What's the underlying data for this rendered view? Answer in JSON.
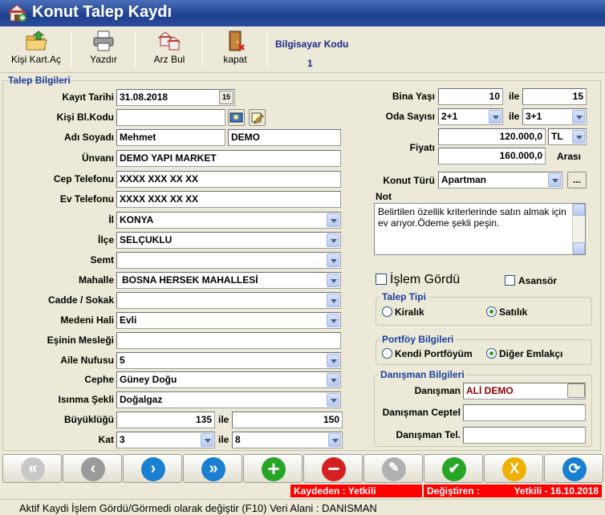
{
  "window": {
    "title": "Konut Talep Kaydı"
  },
  "toolbar": {
    "open_label": "Kişi Kart.Aç",
    "print_label": "Yazdır",
    "find_label": "Arz Bul",
    "close_label": "kapat",
    "pc_code_label": "Bilgisayar Kodu",
    "pc_code_value": "1"
  },
  "section": {
    "title": "Talep Bilgileri"
  },
  "form": {
    "kayit_tarihi": {
      "label": "Kayıt Tarihi",
      "value": "31.08.2018",
      "cal": "15"
    },
    "kisi_bl_kodu": {
      "label": "Kişi Bl.Kodu",
      "value": ""
    },
    "adi_soyadi": {
      "label": "Adı Soyadı",
      "first": "Mehmet",
      "last": "DEMO"
    },
    "unvani": {
      "label": "Ünvanı",
      "value": "DEMO YAPI MARKET"
    },
    "cep_telefonu": {
      "label": "Cep Telefonu",
      "value": "XXXX XXX XX XX"
    },
    "ev_telefonu": {
      "label": "Ev Telefonu",
      "value": "XXXX XXX XX XX"
    },
    "il": {
      "label": "İl",
      "value": "KONYA"
    },
    "ilce": {
      "label": "İlçe",
      "value": "SELÇUKLU"
    },
    "semt": {
      "label": "Semt",
      "value": ""
    },
    "mahalle": {
      "label": "Mahalle",
      "value": "BOSNA HERSEK MAHALLESİ"
    },
    "cadde": {
      "label": "Cadde / Sokak",
      "value": ""
    },
    "medeni_hali": {
      "label": "Medeni Hali",
      "value": "Evli"
    },
    "esinin_meslegi": {
      "label": "Eşinin Mesleği",
      "value": ""
    },
    "aile_nufusu": {
      "label": "Aile Nufusu",
      "value": "5"
    },
    "cephe": {
      "label": "Cephe",
      "value": "Güney Doğu"
    },
    "isinma": {
      "label": "Isınma Şekli",
      "value": "Doğalgaz"
    },
    "buyuklugu": {
      "label": "Büyüklüğü",
      "from": "135",
      "ile": "ile",
      "to": "150"
    },
    "kat": {
      "label": "Kat",
      "from": "3",
      "ile": "ile",
      "to": "8"
    }
  },
  "right": {
    "bina_yasi": {
      "label": "Bina Yaşı",
      "from": "10",
      "ile": "ile",
      "to": "15"
    },
    "oda_sayisi": {
      "label": "Oda Sayısı",
      "from": "2+1",
      "ile": "ile",
      "to": "3+1"
    },
    "fiyati": {
      "label": "Fiyatı",
      "from": "120.000,0",
      "currency": "TL",
      "to": "160.000,0",
      "arasi": "Arası"
    },
    "konut_turu": {
      "label": "Konut Türü",
      "value": "Apartman",
      "btn": "..."
    },
    "not": {
      "label": "Not",
      "value": "Belirtilen özellik kriterlerinde satın almak için ev arıyor.Ödeme şekli peşin."
    },
    "islem_gordu": "İşlem Gördü",
    "asansor": "Asansör",
    "talep_tipi": {
      "title": "Talep Tipi",
      "kiralik": "Kiralık",
      "satilik": "Satılık"
    },
    "portfoy": {
      "title": "Portföy Bilgileri",
      "kendi": "Kendi Portföyüm",
      "diger": "Diğer Emlakçı"
    },
    "danisman": {
      "title": "Danışman Bilgileri",
      "label": "Danışman",
      "value": "ALİ DEMO",
      "ceptel_label": "Danışman Ceptel",
      "ceptel": "",
      "tel_label": "Danışman Tel.",
      "tel": ""
    }
  },
  "status": {
    "kaydeden": "Kaydeden : Yetkili",
    "degistiren_label": "Değiştiren :",
    "degistiren_value": "Yetkili - 16.10.2018",
    "message": "Aktif Kaydi İşlem Gördü/Görmedi olarak değiştir (F10) Veri Alani : DANISMAN"
  },
  "colors": {
    "title_bar": "#1e3f8c",
    "group_title": "#1a3f9c",
    "status_red": "#ff0000",
    "advisor_text": "#8b0000"
  }
}
